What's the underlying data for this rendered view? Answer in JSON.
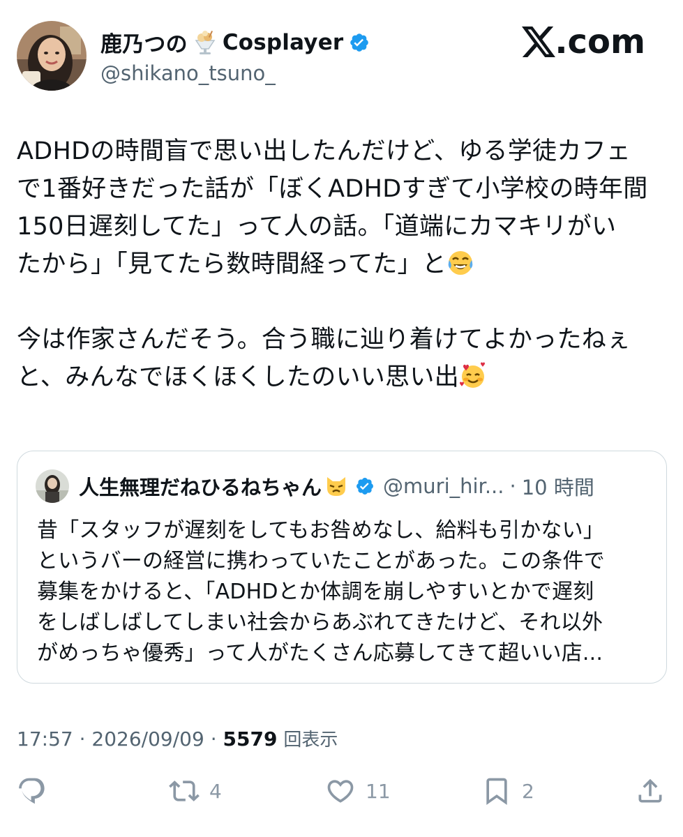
{
  "header": {
    "display_name": "鹿乃つの",
    "display_name_suffix": "Cosplayer",
    "handle": "@shikano_tsuno_",
    "site_label": ".com",
    "avatar_icon": "user-avatar-photo",
    "name_emoji_icon": "parfait-icon",
    "verified_icon": "verified-badge-icon"
  },
  "post": {
    "lines": [
      "ADHDの時間盲で思い出したんだけど、ゆる学徒カフェ",
      "で1番好きだった話が「ぼくADHDすぎて小学校の時年間",
      "150日遅刻してた」って人の話。「道端にカマキリがい",
      "たから」「見てたら数時間経ってた」と"
    ],
    "lines2": [
      "今は作家さんだそう。合う職に辿り着けてよかったねぇ",
      "と、みんなでほくほくしたのいい思い出"
    ],
    "emoji_1": "tears-of-joy-icon",
    "emoji_2": "smiling-face-with-hearts-icon"
  },
  "quote": {
    "name": "人生無理だねひるねちゃん",
    "handle": "@muri_hir...",
    "separator": "·",
    "time": "10 時間",
    "lines": [
      "昔「スタッフが遅刻をしてもお咎めなし、給料も引かない」",
      "というバーの経営に携わっていたことがあった。この条件で",
      "募集をかけると、「ADHDとか体調を崩しやすいとかで遅刻",
      "をしばしばしてしまい社会からあぶれてきたけど、それ以外",
      "がめっちゃ優秀」って人がたくさん応募してきて超いい店..."
    ]
  },
  "meta": {
    "time": "17:57",
    "sep": " · ",
    "date": "2026/09/09",
    "views_count": "5579",
    "views_label": "回表示"
  },
  "actions": {
    "reply_count": "",
    "repost_count": "4",
    "like_count": "11",
    "bookmark_count": "2"
  },
  "colors": {
    "text": "#0f1419",
    "secondary": "#536471",
    "verified": "#1d9bf0",
    "border": "#cfd9de",
    "action": "#8b98a5"
  }
}
